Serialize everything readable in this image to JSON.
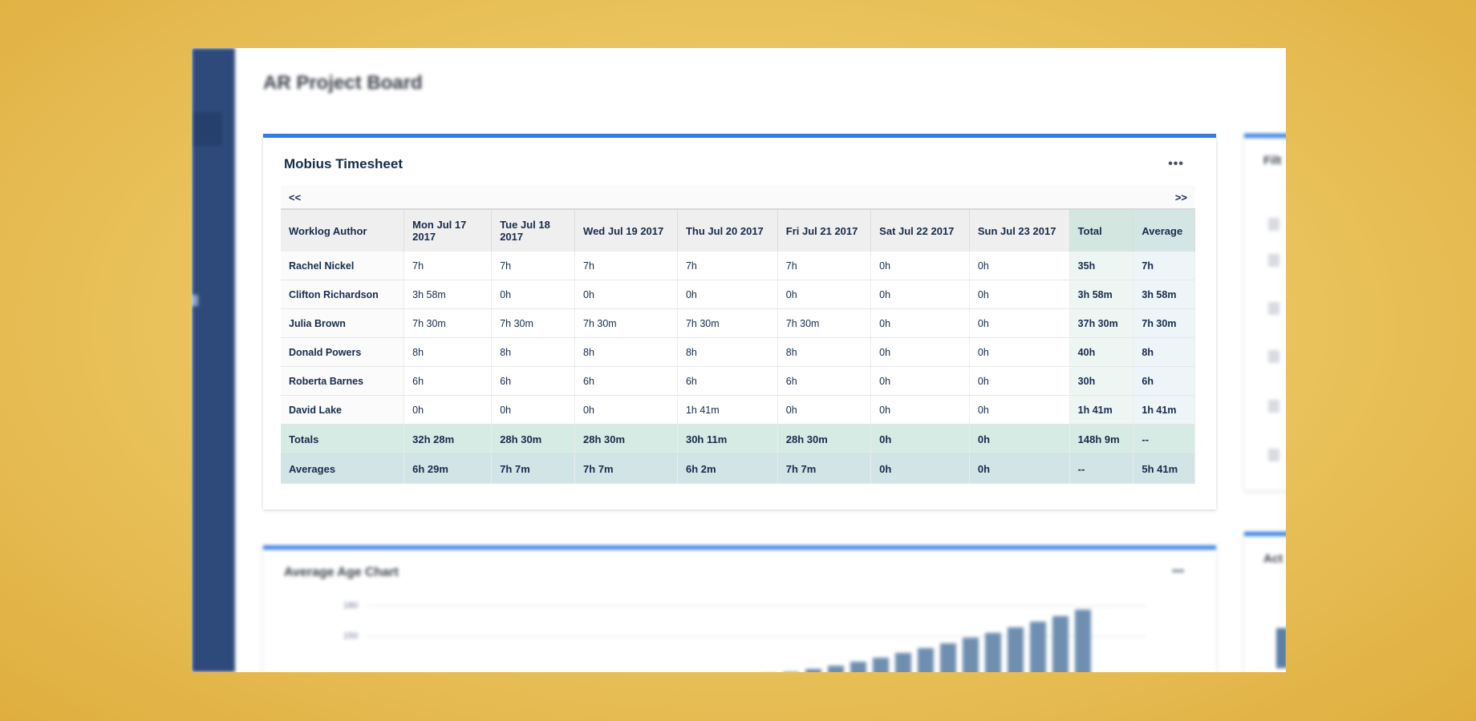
{
  "board": {
    "title": "AR Project Board"
  },
  "timesheet": {
    "title": "Mobius Timesheet",
    "more_label": "•••",
    "prev_label": "<<",
    "next_label": ">>",
    "columns": [
      "Worklog Author",
      "Mon Jul 17 2017",
      "Tue Jul 18 2017",
      "Wed Jul 19 2017",
      "Thu Jul 20 2017",
      "Fri Jul 21 2017",
      "Sat Jul 22 2017",
      "Sun Jul 23 2017",
      "Total",
      "Average"
    ],
    "rows": [
      [
        "Rachel Nickel",
        "7h",
        "7h",
        "7h",
        "7h",
        "7h",
        "0h",
        "0h",
        "35h",
        "7h"
      ],
      [
        "Clifton Richardson",
        "3h 58m",
        "0h",
        "0h",
        "0h",
        "0h",
        "0h",
        "0h",
        "3h 58m",
        "3h 58m"
      ],
      [
        "Julia Brown",
        "7h 30m",
        "7h 30m",
        "7h 30m",
        "7h 30m",
        "7h 30m",
        "0h",
        "0h",
        "37h 30m",
        "7h 30m"
      ],
      [
        "Donald Powers",
        "8h",
        "8h",
        "8h",
        "8h",
        "8h",
        "0h",
        "0h",
        "40h",
        "8h"
      ],
      [
        "Roberta Barnes",
        "6h",
        "6h",
        "6h",
        "6h",
        "6h",
        "0h",
        "0h",
        "30h",
        "6h"
      ],
      [
        "David Lake",
        "0h",
        "0h",
        "0h",
        "1h 41m",
        "0h",
        "0h",
        "0h",
        "1h 41m",
        "1h 41m"
      ]
    ],
    "totals": [
      "Totals",
      "32h 28m",
      "28h 30m",
      "28h 30m",
      "30h 11m",
      "28h 30m",
      "0h",
      "0h",
      "148h 9m",
      "--"
    ],
    "averages": [
      "Averages",
      "6h 29m",
      "7h 7m",
      "7h 7m",
      "6h 2m",
      "7h 7m",
      "0h",
      "0h",
      "--",
      "5h 41m"
    ]
  },
  "age_chart": {
    "title": "Average Age Chart",
    "more_label": "•••",
    "ticks": [
      "180",
      "150"
    ],
    "bars": [
      0.05,
      0.08,
      0.12,
      0.17,
      0.22,
      0.28,
      0.34,
      0.41,
      0.48,
      0.55,
      0.62,
      0.7,
      0.78,
      0.86,
      0.94
    ]
  },
  "right_panels": {
    "filter_title": "Filt",
    "activity_title": "Act"
  }
}
